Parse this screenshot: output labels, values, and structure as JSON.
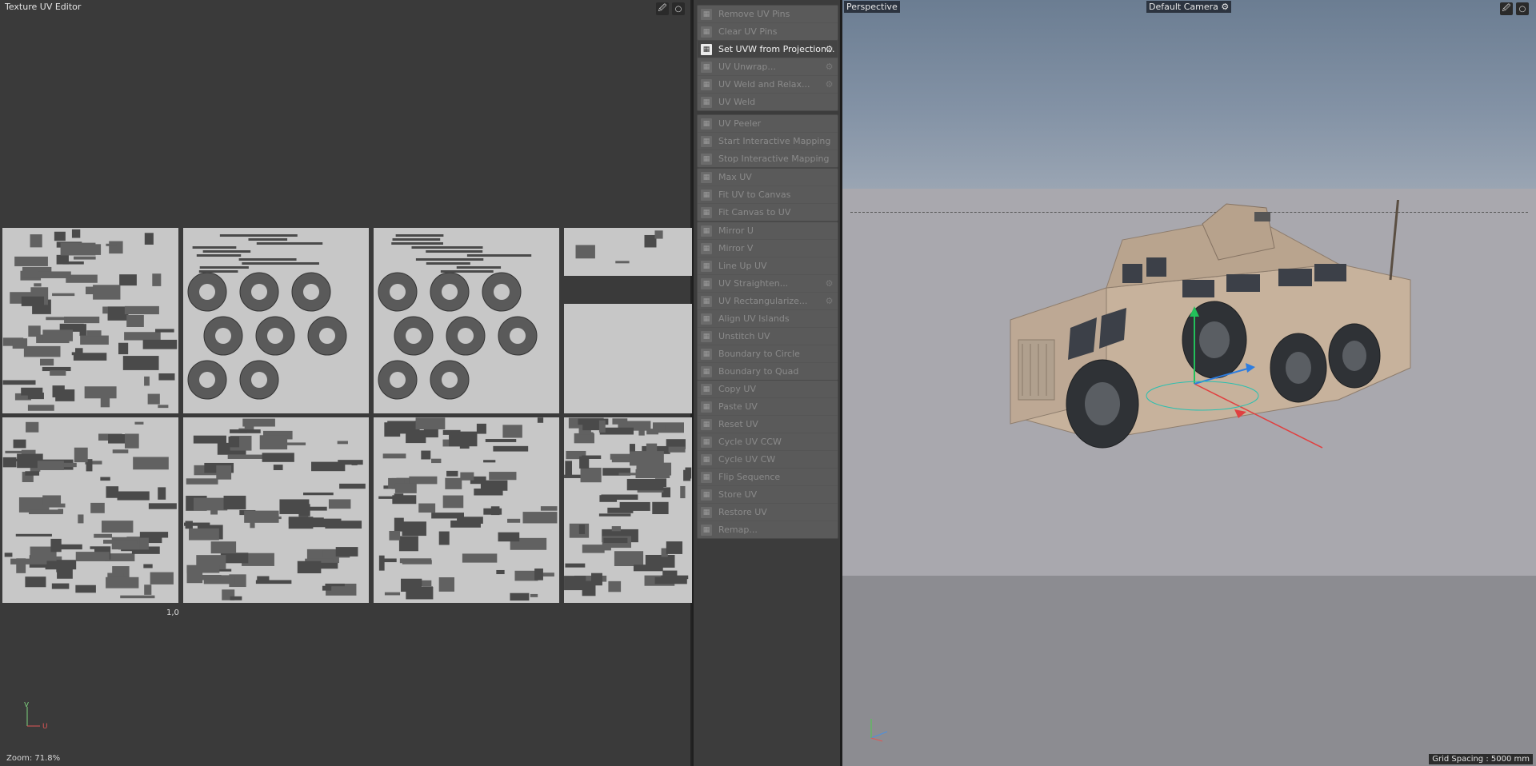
{
  "uv_editor": {
    "title": "Texture UV Editor",
    "coord_label": "1,0",
    "zoom": "Zoom: 71.8%",
    "axis_v": "V",
    "axis_u": "U"
  },
  "commands": {
    "groups": [
      {
        "items": [
          {
            "label": "Remove UV Pins",
            "enabled": false
          },
          {
            "label": "Clear UV Pins",
            "enabled": false
          }
        ]
      },
      {
        "items": [
          {
            "label": "Set UVW from Projection...",
            "enabled": true,
            "gear": true
          },
          {
            "label": "UV Unwrap...",
            "enabled": false,
            "gear": true
          },
          {
            "label": "UV Weld and Relax...",
            "enabled": false,
            "gear": true
          },
          {
            "label": "UV Weld",
            "enabled": false
          }
        ]
      },
      {
        "items": [
          {
            "label": "UV Peeler",
            "enabled": false
          },
          {
            "label": "Start Interactive Mapping",
            "enabled": false
          },
          {
            "label": "Stop Interactive Mapping",
            "enabled": false
          }
        ]
      },
      {
        "items": [
          {
            "label": "Max UV",
            "enabled": false
          },
          {
            "label": "Fit UV to Canvas",
            "enabled": false
          },
          {
            "label": "Fit Canvas to UV",
            "enabled": false
          }
        ]
      },
      {
        "items": [
          {
            "label": "Mirror U",
            "enabled": false
          },
          {
            "label": "Mirror V",
            "enabled": false
          },
          {
            "label": "Line Up UV",
            "enabled": false
          },
          {
            "label": "UV Straighten...",
            "enabled": false,
            "gear": true
          },
          {
            "label": "UV Rectangularize...",
            "enabled": false,
            "gear": true
          },
          {
            "label": "Align UV Islands",
            "enabled": false
          },
          {
            "label": "Unstitch UV",
            "enabled": false
          },
          {
            "label": "Boundary to Circle",
            "enabled": false
          },
          {
            "label": "Boundary to Quad",
            "enabled": false
          }
        ]
      },
      {
        "items": [
          {
            "label": "Copy UV",
            "enabled": false
          },
          {
            "label": "Paste UV",
            "enabled": false
          },
          {
            "label": "Reset UV",
            "enabled": false
          },
          {
            "label": "Cycle UV CCW",
            "enabled": false
          },
          {
            "label": "Cycle UV CW",
            "enabled": false
          },
          {
            "label": "Flip Sequence",
            "enabled": false
          },
          {
            "label": "Store UV",
            "enabled": false
          },
          {
            "label": "Restore UV",
            "enabled": false
          },
          {
            "label": "Remap...",
            "enabled": false
          }
        ]
      }
    ]
  },
  "viewport": {
    "view_name": "Perspective",
    "camera": "Default Camera",
    "grid_spacing": "Grid Spacing : 5000 mm"
  }
}
